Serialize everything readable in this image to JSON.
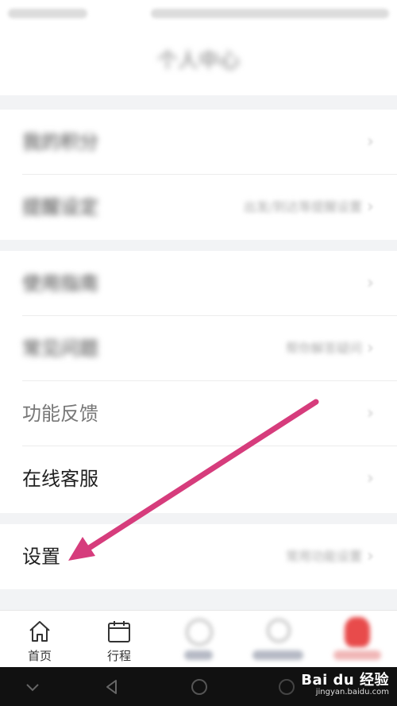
{
  "header": {
    "title": "个人中心"
  },
  "groups": [
    {
      "items": [
        {
          "label": "我的积分",
          "value": "",
          "label_style": "blur"
        },
        {
          "label": "提醒设定",
          "value": "出发/到达等提醒设置",
          "label_style": "blur"
        }
      ]
    },
    {
      "items": [
        {
          "label": "使用指南",
          "value": "",
          "label_style": "blur"
        },
        {
          "label": "常见问题",
          "value": "帮你解答疑问",
          "label_style": "blur"
        },
        {
          "label": "功能反馈",
          "value": "",
          "label_style": "soft"
        },
        {
          "label": "在线客服",
          "value": "",
          "label_style": "sharp"
        }
      ]
    },
    {
      "items": [
        {
          "label": "设置",
          "value": "常用功能设置",
          "label_style": "sharp"
        }
      ]
    }
  ],
  "tabs": [
    {
      "label": "首页",
      "icon": "home-icon"
    },
    {
      "label": "行程",
      "icon": "calendar-icon"
    },
    {
      "label": "",
      "icon": "discover-icon"
    },
    {
      "label": "",
      "icon": "message-icon"
    },
    {
      "label": "",
      "icon": "profile-icon"
    }
  ],
  "watermark": {
    "main": "Bai du 经验",
    "sub": "jingyan.baidu.com"
  },
  "colors": {
    "arrow": "#d63c7c",
    "accent": "#e84b4b"
  }
}
